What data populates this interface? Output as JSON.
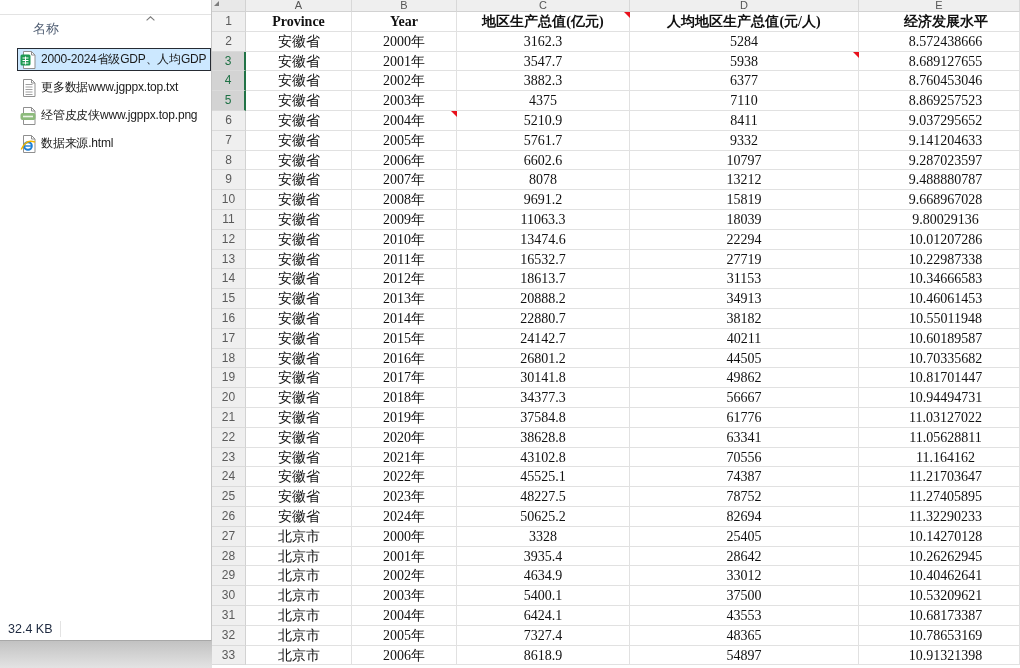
{
  "file_explorer": {
    "column_header": {
      "label": "名称",
      "sort_ascending": true
    },
    "files": [
      {
        "name": "2000-2024省级GDP、人均GDP",
        "kind": "spreadsheet",
        "selected": true
      },
      {
        "name": "更多数据www.jgppx.top.txt",
        "kind": "text",
        "selected": false
      },
      {
        "name": "经管皮皮侠www.jgppx.top.png",
        "kind": "image",
        "selected": false
      },
      {
        "name": "数据来源.html",
        "kind": "web",
        "selected": false
      }
    ],
    "status_bar": {
      "size": "32.4 KB"
    }
  },
  "spreadsheet": {
    "columns": [
      "A",
      "B",
      "C",
      "D",
      "E"
    ],
    "rows": [
      {
        "number": "1",
        "kind": "header",
        "selected": false,
        "cells": [
          {
            "text": "Province",
            "comment": false
          },
          {
            "text": "Year",
            "comment": false
          },
          {
            "text": "地区生产总值(亿元)",
            "comment": true
          },
          {
            "text": "人均地区生产总值(元/人)",
            "comment": false
          },
          {
            "text": "经济发展水平",
            "comment": false
          }
        ]
      },
      {
        "number": "2",
        "kind": "data",
        "selected": false,
        "cells": [
          {
            "text": "安徽省",
            "comment": false
          },
          {
            "text": "2000年",
            "comment": false
          },
          {
            "text": "3162.3",
            "comment": false
          },
          {
            "text": "5284",
            "comment": false
          },
          {
            "text": "8.572438666",
            "comment": false
          }
        ]
      },
      {
        "number": "3",
        "kind": "data",
        "selected": true,
        "cells": [
          {
            "text": "安徽省",
            "comment": false
          },
          {
            "text": "2001年",
            "comment": false
          },
          {
            "text": "3547.7",
            "comment": false
          },
          {
            "text": "5938",
            "comment": true
          },
          {
            "text": "8.689127655",
            "comment": false
          }
        ]
      },
      {
        "number": "4",
        "kind": "data",
        "selected": true,
        "cells": [
          {
            "text": "安徽省",
            "comment": false
          },
          {
            "text": "2002年",
            "comment": false
          },
          {
            "text": "3882.3",
            "comment": false
          },
          {
            "text": "6377",
            "comment": false
          },
          {
            "text": "8.760453046",
            "comment": false
          }
        ]
      },
      {
        "number": "5",
        "kind": "data",
        "selected": true,
        "cells": [
          {
            "text": "安徽省",
            "comment": false
          },
          {
            "text": "2003年",
            "comment": false
          },
          {
            "text": "4375",
            "comment": false
          },
          {
            "text": "7110",
            "comment": false
          },
          {
            "text": "8.869257523",
            "comment": false
          }
        ]
      },
      {
        "number": "6",
        "kind": "data",
        "selected": false,
        "cells": [
          {
            "text": "安徽省",
            "comment": false
          },
          {
            "text": "2004年",
            "comment": true
          },
          {
            "text": "5210.9",
            "comment": false
          },
          {
            "text": "8411",
            "comment": false
          },
          {
            "text": "9.037295652",
            "comment": false
          }
        ]
      },
      {
        "number": "7",
        "kind": "data",
        "selected": false,
        "cells": [
          {
            "text": "安徽省",
            "comment": false
          },
          {
            "text": "2005年",
            "comment": false
          },
          {
            "text": "5761.7",
            "comment": false
          },
          {
            "text": "9332",
            "comment": false
          },
          {
            "text": "9.141204633",
            "comment": false
          }
        ]
      },
      {
        "number": "8",
        "kind": "data",
        "selected": false,
        "cells": [
          {
            "text": "安徽省",
            "comment": false
          },
          {
            "text": "2006年",
            "comment": false
          },
          {
            "text": "6602.6",
            "comment": false
          },
          {
            "text": "10797",
            "comment": false
          },
          {
            "text": "9.287023597",
            "comment": false
          }
        ]
      },
      {
        "number": "9",
        "kind": "data",
        "selected": false,
        "cells": [
          {
            "text": "安徽省",
            "comment": false
          },
          {
            "text": "2007年",
            "comment": false
          },
          {
            "text": "8078",
            "comment": false
          },
          {
            "text": "13212",
            "comment": false
          },
          {
            "text": "9.488880787",
            "comment": false
          }
        ]
      },
      {
        "number": "10",
        "kind": "data",
        "selected": false,
        "cells": [
          {
            "text": "安徽省",
            "comment": false
          },
          {
            "text": "2008年",
            "comment": false
          },
          {
            "text": "9691.2",
            "comment": false
          },
          {
            "text": "15819",
            "comment": false
          },
          {
            "text": "9.668967028",
            "comment": false
          }
        ]
      },
      {
        "number": "11",
        "kind": "data",
        "selected": false,
        "cells": [
          {
            "text": "安徽省",
            "comment": false
          },
          {
            "text": "2009年",
            "comment": false
          },
          {
            "text": "11063.3",
            "comment": false
          },
          {
            "text": "18039",
            "comment": false
          },
          {
            "text": "9.80029136",
            "comment": false
          }
        ]
      },
      {
        "number": "12",
        "kind": "data",
        "selected": false,
        "cells": [
          {
            "text": "安徽省",
            "comment": false
          },
          {
            "text": "2010年",
            "comment": false
          },
          {
            "text": "13474.6",
            "comment": false
          },
          {
            "text": "22294",
            "comment": false
          },
          {
            "text": "10.01207286",
            "comment": false
          }
        ]
      },
      {
        "number": "13",
        "kind": "data",
        "selected": false,
        "cells": [
          {
            "text": "安徽省",
            "comment": false
          },
          {
            "text": "2011年",
            "comment": false
          },
          {
            "text": "16532.7",
            "comment": false
          },
          {
            "text": "27719",
            "comment": false
          },
          {
            "text": "10.22987338",
            "comment": false
          }
        ]
      },
      {
        "number": "14",
        "kind": "data",
        "selected": false,
        "cells": [
          {
            "text": "安徽省",
            "comment": false
          },
          {
            "text": "2012年",
            "comment": false
          },
          {
            "text": "18613.7",
            "comment": false
          },
          {
            "text": "31153",
            "comment": false
          },
          {
            "text": "10.34666583",
            "comment": false
          }
        ]
      },
      {
        "number": "15",
        "kind": "data",
        "selected": false,
        "cells": [
          {
            "text": "安徽省",
            "comment": false
          },
          {
            "text": "2013年",
            "comment": false
          },
          {
            "text": "20888.2",
            "comment": false
          },
          {
            "text": "34913",
            "comment": false
          },
          {
            "text": "10.46061453",
            "comment": false
          }
        ]
      },
      {
        "number": "16",
        "kind": "data",
        "selected": false,
        "cells": [
          {
            "text": "安徽省",
            "comment": false
          },
          {
            "text": "2014年",
            "comment": false
          },
          {
            "text": "22880.7",
            "comment": false
          },
          {
            "text": "38182",
            "comment": false
          },
          {
            "text": "10.55011948",
            "comment": false
          }
        ]
      },
      {
        "number": "17",
        "kind": "data",
        "selected": false,
        "cells": [
          {
            "text": "安徽省",
            "comment": false
          },
          {
            "text": "2015年",
            "comment": false
          },
          {
            "text": "24142.7",
            "comment": false
          },
          {
            "text": "40211",
            "comment": false
          },
          {
            "text": "10.60189587",
            "comment": false
          }
        ]
      },
      {
        "number": "18",
        "kind": "data",
        "selected": false,
        "cells": [
          {
            "text": "安徽省",
            "comment": false
          },
          {
            "text": "2016年",
            "comment": false
          },
          {
            "text": "26801.2",
            "comment": false
          },
          {
            "text": "44505",
            "comment": false
          },
          {
            "text": "10.70335682",
            "comment": false
          }
        ]
      },
      {
        "number": "19",
        "kind": "data",
        "selected": false,
        "cells": [
          {
            "text": "安徽省",
            "comment": false
          },
          {
            "text": "2017年",
            "comment": false
          },
          {
            "text": "30141.8",
            "comment": false
          },
          {
            "text": "49862",
            "comment": false
          },
          {
            "text": "10.81701447",
            "comment": false
          }
        ]
      },
      {
        "number": "20",
        "kind": "data",
        "selected": false,
        "cells": [
          {
            "text": "安徽省",
            "comment": false
          },
          {
            "text": "2018年",
            "comment": false
          },
          {
            "text": "34377.3",
            "comment": false
          },
          {
            "text": "56667",
            "comment": false
          },
          {
            "text": "10.94494731",
            "comment": false
          }
        ]
      },
      {
        "number": "21",
        "kind": "data",
        "selected": false,
        "cells": [
          {
            "text": "安徽省",
            "comment": false
          },
          {
            "text": "2019年",
            "comment": false
          },
          {
            "text": "37584.8",
            "comment": false
          },
          {
            "text": "61776",
            "comment": false
          },
          {
            "text": "11.03127022",
            "comment": false
          }
        ]
      },
      {
        "number": "22",
        "kind": "data",
        "selected": false,
        "cells": [
          {
            "text": "安徽省",
            "comment": false
          },
          {
            "text": "2020年",
            "comment": false
          },
          {
            "text": "38628.8",
            "comment": false
          },
          {
            "text": "63341",
            "comment": false
          },
          {
            "text": "11.05628811",
            "comment": false
          }
        ]
      },
      {
        "number": "23",
        "kind": "data",
        "selected": false,
        "cells": [
          {
            "text": "安徽省",
            "comment": false
          },
          {
            "text": "2021年",
            "comment": false
          },
          {
            "text": "43102.8",
            "comment": false
          },
          {
            "text": "70556",
            "comment": false
          },
          {
            "text": "11.164162",
            "comment": false
          }
        ]
      },
      {
        "number": "24",
        "kind": "data",
        "selected": false,
        "cells": [
          {
            "text": "安徽省",
            "comment": false
          },
          {
            "text": "2022年",
            "comment": false
          },
          {
            "text": "45525.1",
            "comment": false
          },
          {
            "text": "74387",
            "comment": false
          },
          {
            "text": "11.21703647",
            "comment": false
          }
        ]
      },
      {
        "number": "25",
        "kind": "data",
        "selected": false,
        "cells": [
          {
            "text": "安徽省",
            "comment": false
          },
          {
            "text": "2023年",
            "comment": false
          },
          {
            "text": "48227.5",
            "comment": false
          },
          {
            "text": "78752",
            "comment": false
          },
          {
            "text": "11.27405895",
            "comment": false
          }
        ]
      },
      {
        "number": "26",
        "kind": "data",
        "selected": false,
        "cells": [
          {
            "text": "安徽省",
            "comment": false
          },
          {
            "text": "2024年",
            "comment": false
          },
          {
            "text": "50625.2",
            "comment": false
          },
          {
            "text": "82694",
            "comment": false
          },
          {
            "text": "11.32290233",
            "comment": false
          }
        ]
      },
      {
        "number": "27",
        "kind": "data",
        "selected": false,
        "cells": [
          {
            "text": "北京市",
            "comment": false
          },
          {
            "text": "2000年",
            "comment": false
          },
          {
            "text": "3328",
            "comment": false
          },
          {
            "text": "25405",
            "comment": false
          },
          {
            "text": "10.14270128",
            "comment": false
          }
        ]
      },
      {
        "number": "28",
        "kind": "data",
        "selected": false,
        "cells": [
          {
            "text": "北京市",
            "comment": false
          },
          {
            "text": "2001年",
            "comment": false
          },
          {
            "text": "3935.4",
            "comment": false
          },
          {
            "text": "28642",
            "comment": false
          },
          {
            "text": "10.26262945",
            "comment": false
          }
        ]
      },
      {
        "number": "29",
        "kind": "data",
        "selected": false,
        "cells": [
          {
            "text": "北京市",
            "comment": false
          },
          {
            "text": "2002年",
            "comment": false
          },
          {
            "text": "4634.9",
            "comment": false
          },
          {
            "text": "33012",
            "comment": false
          },
          {
            "text": "10.40462641",
            "comment": false
          }
        ]
      },
      {
        "number": "30",
        "kind": "data",
        "selected": false,
        "cells": [
          {
            "text": "北京市",
            "comment": false
          },
          {
            "text": "2003年",
            "comment": false
          },
          {
            "text": "5400.1",
            "comment": false
          },
          {
            "text": "37500",
            "comment": false
          },
          {
            "text": "10.53209621",
            "comment": false
          }
        ]
      },
      {
        "number": "31",
        "kind": "data",
        "selected": false,
        "cells": [
          {
            "text": "北京市",
            "comment": false
          },
          {
            "text": "2004年",
            "comment": false
          },
          {
            "text": "6424.1",
            "comment": false
          },
          {
            "text": "43553",
            "comment": false
          },
          {
            "text": "10.68173387",
            "comment": false
          }
        ]
      },
      {
        "number": "32",
        "kind": "data",
        "selected": false,
        "cells": [
          {
            "text": "北京市",
            "comment": false
          },
          {
            "text": "2005年",
            "comment": false
          },
          {
            "text": "7327.4",
            "comment": false
          },
          {
            "text": "48365",
            "comment": false
          },
          {
            "text": "10.78653169",
            "comment": false
          }
        ]
      },
      {
        "number": "33",
        "kind": "data",
        "selected": false,
        "cells": [
          {
            "text": "北京市",
            "comment": false
          },
          {
            "text": "2006年",
            "comment": false
          },
          {
            "text": "8618.9",
            "comment": false
          },
          {
            "text": "54897",
            "comment": false
          },
          {
            "text": "10.91321398",
            "comment": false
          }
        ]
      }
    ]
  }
}
